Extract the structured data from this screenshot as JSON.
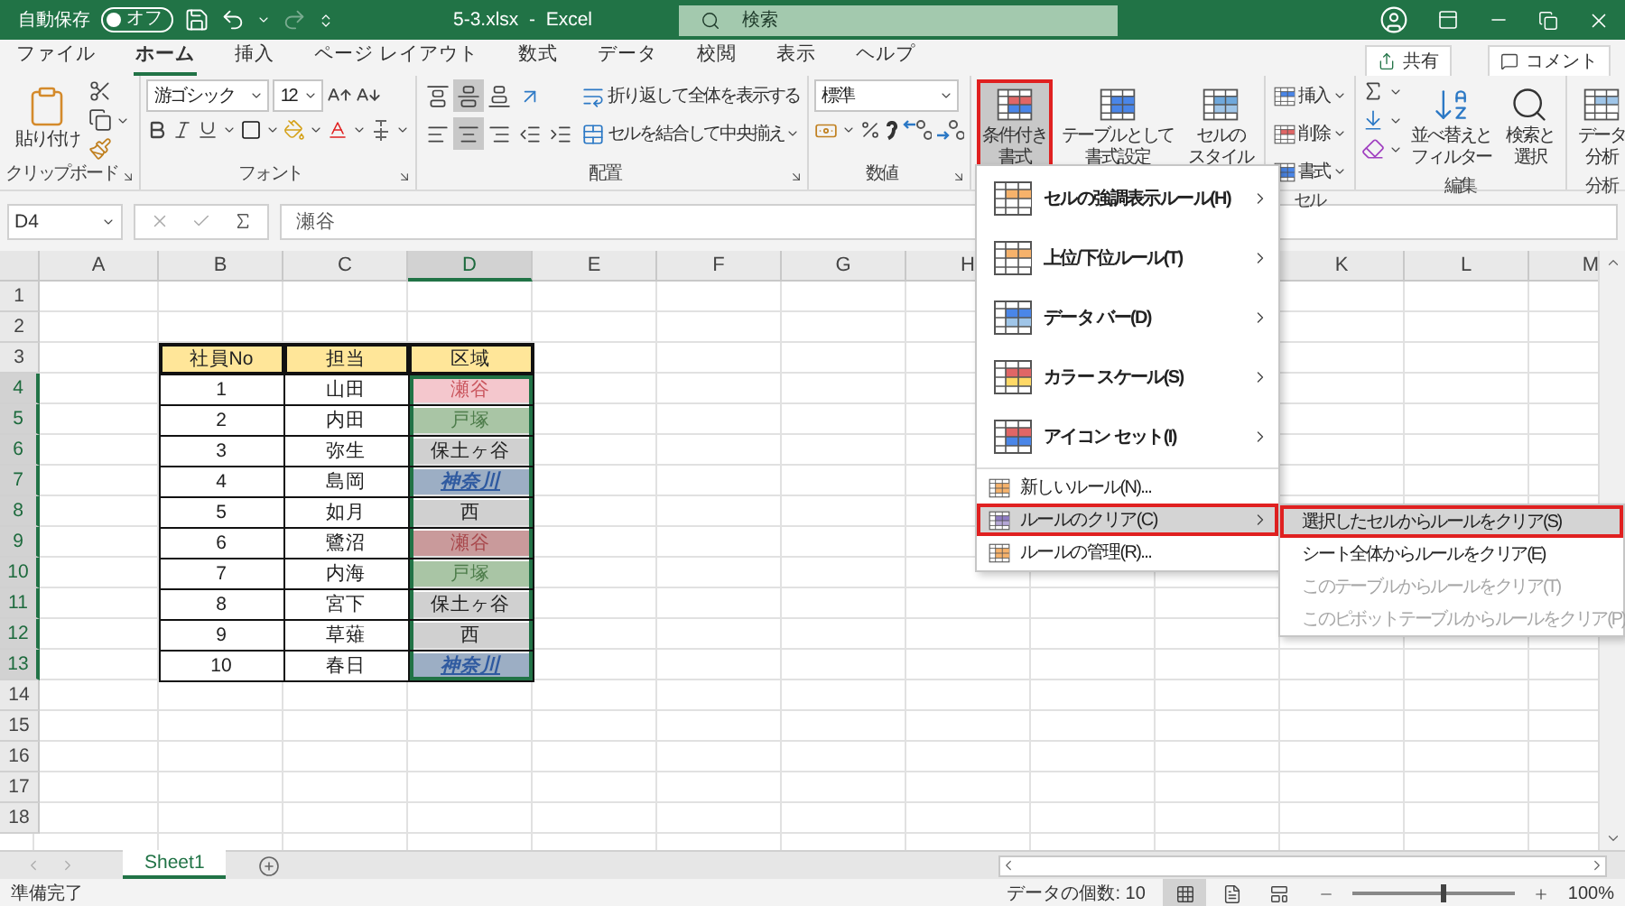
{
  "title_bar": {
    "autosave_label": "自動保存",
    "autosave": {
      "label": "オフ",
      "on": false
    },
    "redo_disabled": true,
    "title": "5-3.xlsx  -  Excel",
    "search_placeholder": "検索"
  },
  "ribbon_tabs": [
    {
      "label": "ファイル",
      "selected": false
    },
    {
      "label": "ホーム",
      "selected": true
    },
    {
      "label": "挿入",
      "selected": false
    },
    {
      "label": "ページ レイアウト",
      "selected": false
    },
    {
      "label": "数式",
      "selected": false
    },
    {
      "label": "データ",
      "selected": false
    },
    {
      "label": "校閲",
      "selected": false
    },
    {
      "label": "表示",
      "selected": false
    },
    {
      "label": "ヘルプ",
      "selected": false
    }
  ],
  "share": "共有",
  "comment": "コメント",
  "ribbon": {
    "clipboard": {
      "paste": "貼り付け",
      "label": "クリップボード"
    },
    "font": {
      "name": "游ゴシック",
      "size": "12",
      "label": "フォント"
    },
    "alignment": {
      "wrap": "折り返して全体を表示する",
      "merge": "セルを結合して中央揃え",
      "label": "配置"
    },
    "number": {
      "format": "標準",
      "label": "数値"
    },
    "styles": [
      {
        "lines": [
          "条件付き",
          "書式"
        ],
        "selected": true
      },
      {
        "lines": [
          "テーブルとして",
          "書式設定"
        ],
        "selected": false
      },
      {
        "lines": [
          "セルの",
          "スタイル"
        ],
        "selected": false
      }
    ],
    "cells": {
      "items": [
        "挿入",
        "削除",
        "書式"
      ],
      "label": "セル"
    },
    "editing": {
      "buttons": [
        {
          "lines": [
            "並べ替えと",
            "フィルター"
          ]
        },
        {
          "lines": [
            "検索と",
            "選択"
          ]
        }
      ],
      "label": "編集"
    },
    "analysis": {
      "lines": [
        "データ",
        "分析"
      ],
      "label": "分析"
    }
  },
  "formula_bar": {
    "name_box": "D4",
    "value": "瀬谷"
  },
  "sheet": {
    "columns": [
      {
        "label": "A",
        "selected": false
      },
      {
        "label": "B",
        "selected": false
      },
      {
        "label": "C",
        "selected": false
      },
      {
        "label": "D",
        "selected": true
      },
      {
        "label": "E",
        "selected": false
      },
      {
        "label": "F",
        "selected": false
      },
      {
        "label": "G",
        "selected": false
      },
      {
        "label": "H",
        "selected": false
      },
      {
        "label": "K",
        "selected": false
      },
      {
        "label": "L",
        "selected": false
      },
      {
        "label": "M",
        "selected": false
      }
    ],
    "rows": [
      {
        "label": "1",
        "selected": false
      },
      {
        "label": "2",
        "selected": false
      },
      {
        "label": "3",
        "selected": false
      },
      {
        "label": "4",
        "selected": true
      },
      {
        "label": "5",
        "selected": true
      },
      {
        "label": "6",
        "selected": true
      },
      {
        "label": "7",
        "selected": true
      },
      {
        "label": "8",
        "selected": true
      },
      {
        "label": "9",
        "selected": true
      },
      {
        "label": "10",
        "selected": true
      },
      {
        "label": "11",
        "selected": true
      },
      {
        "label": "12",
        "selected": true
      },
      {
        "label": "13",
        "selected": true
      },
      {
        "label": "14",
        "selected": false
      },
      {
        "label": "15",
        "selected": false
      },
      {
        "label": "16",
        "selected": false
      },
      {
        "label": "17",
        "selected": false
      },
      {
        "label": "18",
        "selected": false
      }
    ],
    "table": {
      "header": [
        "社員No",
        "担当",
        "区域"
      ],
      "rows": [
        {
          "no": "1",
          "person": "山田",
          "area": "瀬谷",
          "color": "#f4c7cd",
          "kind": "alert"
        },
        {
          "no": "2",
          "person": "内田",
          "area": "戸塚",
          "color": "#a9c5a5",
          "kind": "good"
        },
        {
          "no": "3",
          "person": "弥生",
          "area": "保土ヶ谷",
          "color": "#d0d0d0",
          "kind": "plain"
        },
        {
          "no": "4",
          "person": "島岡",
          "area": "神奈川",
          "color": "#9caec4",
          "kind": "emphasis"
        },
        {
          "no": "5",
          "person": "如月",
          "area": "西",
          "color": "#d0d0d0",
          "kind": "plain"
        },
        {
          "no": "6",
          "person": "鷺沼",
          "area": "瀬谷",
          "color": "#c99a9b",
          "kind": "warning"
        },
        {
          "no": "7",
          "person": "内海",
          "area": "戸塚",
          "color": "#a9c5a5",
          "kind": "good"
        },
        {
          "no": "8",
          "person": "宮下",
          "area": "保土ヶ谷",
          "color": "#d0d0d0",
          "kind": "plain"
        },
        {
          "no": "9",
          "person": "草薙",
          "area": "西",
          "color": "#d0d0d0",
          "kind": "plain"
        },
        {
          "no": "10",
          "person": "春日",
          "area": "神奈川",
          "color": "#9caec4",
          "kind": "emphasis"
        }
      ]
    }
  },
  "menu": {
    "items": [
      {
        "kind": "large",
        "label": "セルの強調表示ルール(H)",
        "submenu": true,
        "selected": false
      },
      {
        "kind": "large",
        "label": "上位/下位ルール(T)",
        "submenu": true,
        "selected": false
      },
      {
        "kind": "large",
        "label": "データ バー(D)",
        "submenu": true,
        "selected": false
      },
      {
        "kind": "large",
        "label": "カラー スケール(S)",
        "submenu": true,
        "selected": false
      },
      {
        "kind": "large",
        "label": "アイコン セット(I)",
        "submenu": true,
        "selected": false
      },
      {
        "kind": "small",
        "label": "新しいルール(N)...",
        "submenu": false,
        "selected": false
      },
      {
        "kind": "small",
        "label": "ルールのクリア(C)",
        "submenu": true,
        "selected": true
      },
      {
        "kind": "small",
        "label": "ルールの管理(R)...",
        "submenu": false,
        "selected": false
      }
    ],
    "submenu": [
      {
        "label": "選択したセルからルールをクリア(S)",
        "selected": true,
        "disabled": false
      },
      {
        "label": "シート全体からルールをクリア(E)",
        "selected": false,
        "disabled": false
      },
      {
        "label": "このテーブルからルールをクリア(T)",
        "selected": false,
        "disabled": true
      },
      {
        "label": "このピボットテーブルからルールをクリア(P)",
        "selected": false,
        "disabled": true
      }
    ]
  },
  "sheet_tabs": [
    {
      "label": "Sheet1",
      "selected": true
    }
  ],
  "status_bar": {
    "status": "準備完了",
    "count": "データの個数: 10",
    "views": [
      {
        "selected": true
      },
      {
        "selected": false
      },
      {
        "selected": false
      }
    ],
    "zoom": {
      "level": 0.55,
      "reading": "100%"
    }
  }
}
